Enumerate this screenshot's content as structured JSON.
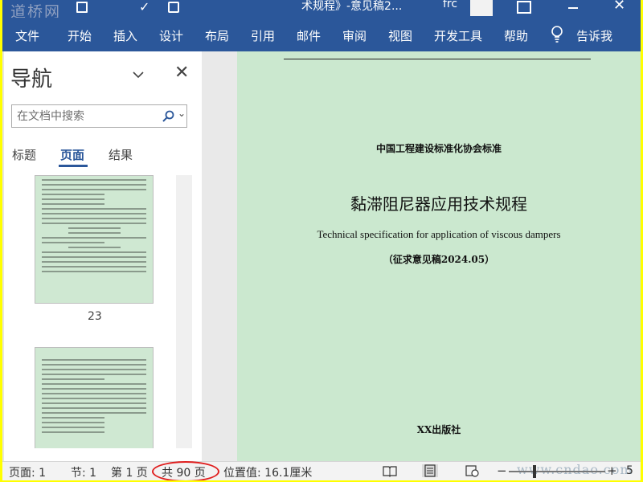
{
  "window": {
    "watermark": "道桥网",
    "doc_title": "术规程》-意见稿2...",
    "user": "frc"
  },
  "menu": {
    "tabs": [
      "文件",
      "开始",
      "插入",
      "设计",
      "布局",
      "引用",
      "邮件",
      "审阅",
      "视图",
      "开发工具",
      "帮助",
      "告诉我"
    ]
  },
  "nav": {
    "title": "导航",
    "search_placeholder": "在文档中搜索",
    "tabs": [
      "标题",
      "页面",
      "结果"
    ],
    "active_tab": "页面",
    "thumbnail_page_label": "23"
  },
  "document": {
    "org_standard": "中国工程建设标准化协会标准",
    "title_cn": "黏滞阻尼器应用技术规程",
    "title_en": "Technical specification for application of viscous dampers",
    "draft_note": "（征求意见稿2024.05）",
    "publisher": "XX出版社"
  },
  "status": {
    "page": "页面: 1",
    "section": "节: 1",
    "page_of": "第 1 页",
    "total_pages": "共 90 页",
    "position": "位置值: 16.1厘米",
    "zoom": "5",
    "watermark": "www.cndao.com"
  },
  "colors": {
    "ribbon": "#2b579a",
    "page_bg": "#cbe8cf",
    "highlight_oval": "#e02020",
    "frame": "#ffff00"
  }
}
